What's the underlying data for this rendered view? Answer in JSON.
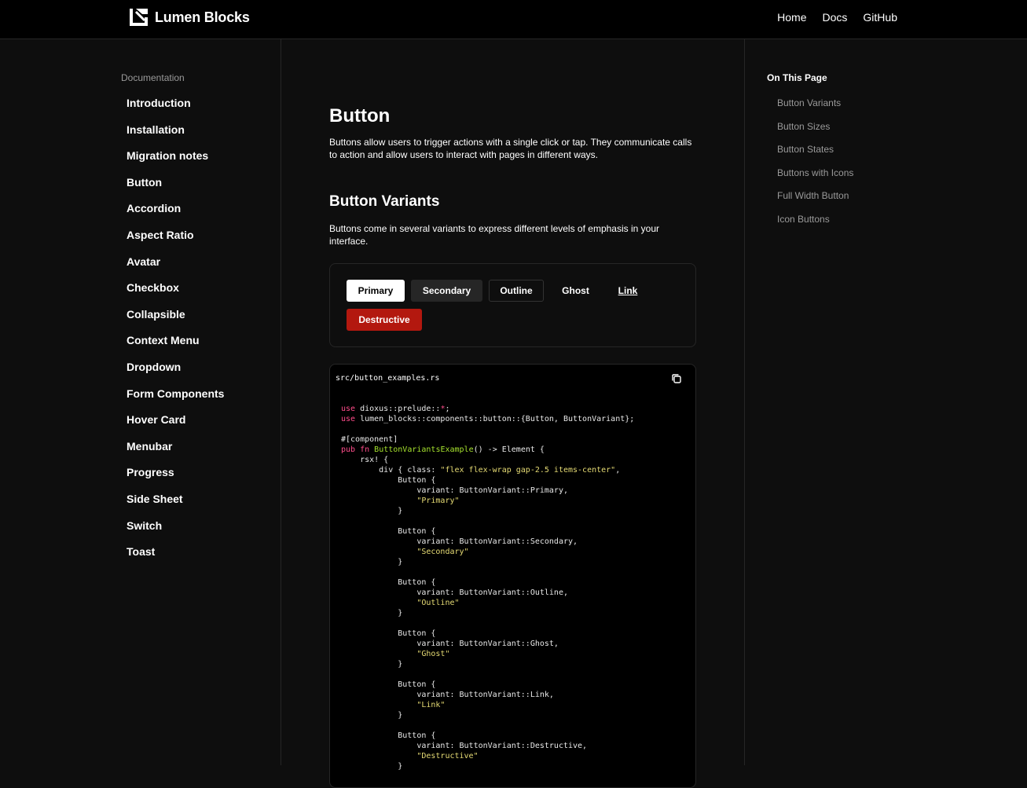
{
  "header": {
    "brand": "Lumen Blocks",
    "nav": [
      "Home",
      "Docs",
      "GitHub"
    ]
  },
  "sidebar": {
    "section": "Documentation",
    "items": [
      "Introduction",
      "Installation",
      "Migration notes",
      "Button",
      "Accordion",
      "Aspect Ratio",
      "Avatar",
      "Checkbox",
      "Collapsible",
      "Context Menu",
      "Dropdown",
      "Form Components",
      "Hover Card",
      "Menubar",
      "Progress",
      "Side Sheet",
      "Switch",
      "Toast"
    ]
  },
  "main": {
    "title": "Button",
    "description": "Buttons allow users to trigger actions with a single click or tap. They communicate calls to action and allow users to interact with pages in different ways.",
    "section_title": "Button Variants",
    "section_description": "Buttons come in several variants to express different levels of emphasis in your interface.",
    "buttons": {
      "primary": "Primary",
      "secondary": "Secondary",
      "outline": "Outline",
      "ghost": "Ghost",
      "link": "Link",
      "destructive": "Destructive"
    },
    "code": {
      "filename": "src/button_examples.rs",
      "lines": [
        [
          [
            "kw",
            "use"
          ],
          [
            "t",
            " dioxus::prelude::"
          ],
          [
            "kw",
            "*"
          ],
          [
            "t",
            ";"
          ]
        ],
        [
          [
            "kw",
            "use"
          ],
          [
            "t",
            " lumen_blocks::components::button::{Button, ButtonVariant};"
          ]
        ],
        [],
        [
          [
            "t",
            "#[component]"
          ]
        ],
        [
          [
            "kw",
            "pub"
          ],
          [
            "t",
            " "
          ],
          [
            "kw",
            "fn"
          ],
          [
            "t",
            " "
          ],
          [
            "fn",
            "ButtonVariantsExample"
          ],
          [
            "t",
            "() -> Element {"
          ]
        ],
        [
          [
            "t",
            "    rsx! {"
          ]
        ],
        [
          [
            "t",
            "        div { class: "
          ],
          [
            "str",
            "\"flex flex-wrap gap-2.5 items-center\""
          ],
          [
            "t",
            ","
          ]
        ],
        [
          [
            "t",
            "            Button {"
          ]
        ],
        [
          [
            "t",
            "                variant: ButtonVariant::Primary,"
          ]
        ],
        [
          [
            "t",
            "                "
          ],
          [
            "str",
            "\"Primary\""
          ]
        ],
        [
          [
            "t",
            "            }"
          ]
        ],
        [],
        [
          [
            "t",
            "            Button {"
          ]
        ],
        [
          [
            "t",
            "                variant: ButtonVariant::Secondary,"
          ]
        ],
        [
          [
            "t",
            "                "
          ],
          [
            "str",
            "\"Secondary\""
          ]
        ],
        [
          [
            "t",
            "            }"
          ]
        ],
        [],
        [
          [
            "t",
            "            Button {"
          ]
        ],
        [
          [
            "t",
            "                variant: ButtonVariant::Outline,"
          ]
        ],
        [
          [
            "t",
            "                "
          ],
          [
            "str",
            "\"Outline\""
          ]
        ],
        [
          [
            "t",
            "            }"
          ]
        ],
        [],
        [
          [
            "t",
            "            Button {"
          ]
        ],
        [
          [
            "t",
            "                variant: ButtonVariant::Ghost,"
          ]
        ],
        [
          [
            "t",
            "                "
          ],
          [
            "str",
            "\"Ghost\""
          ]
        ],
        [
          [
            "t",
            "            }"
          ]
        ],
        [],
        [
          [
            "t",
            "            Button {"
          ]
        ],
        [
          [
            "t",
            "                variant: ButtonVariant::Link,"
          ]
        ],
        [
          [
            "t",
            "                "
          ],
          [
            "str",
            "\"Link\""
          ]
        ],
        [
          [
            "t",
            "            }"
          ]
        ],
        [],
        [
          [
            "t",
            "            Button {"
          ]
        ],
        [
          [
            "t",
            "                variant: ButtonVariant::Destructive,"
          ]
        ],
        [
          [
            "t",
            "                "
          ],
          [
            "str",
            "\"Destructive\""
          ]
        ],
        [
          [
            "t",
            "            }"
          ]
        ]
      ]
    }
  },
  "toc": {
    "title": "On This Page",
    "items": [
      "Button Variants",
      "Button Sizes",
      "Button States",
      "Buttons with Icons",
      "Full Width Button",
      "Icon Buttons"
    ]
  },
  "colors": {
    "background": "#0e0e0e",
    "header": "#000000",
    "border": "#262626",
    "destructive": "#b3180f",
    "keyword": "#ff4d8b",
    "function": "#a6e22e",
    "string": "#e6db74"
  }
}
